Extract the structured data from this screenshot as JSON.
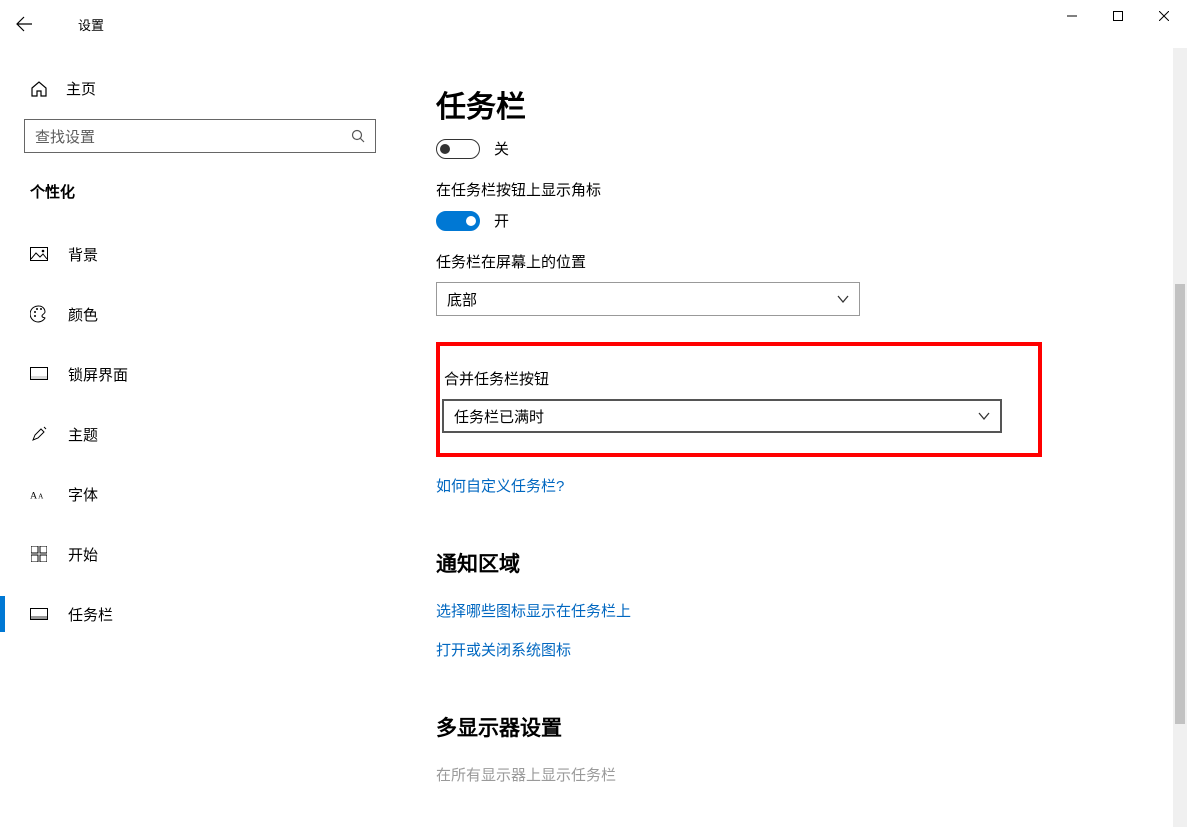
{
  "titlebar": {
    "title": "设置"
  },
  "sidebar": {
    "home": "主页",
    "search_placeholder": "查找设置",
    "section": "个性化",
    "items": [
      {
        "label": "背景"
      },
      {
        "label": "颜色"
      },
      {
        "label": "锁屏界面"
      },
      {
        "label": "主题"
      },
      {
        "label": "字体"
      },
      {
        "label": "开始"
      },
      {
        "label": "任务栏"
      }
    ]
  },
  "content": {
    "page_title": "任务栏",
    "toggle1_state": "关",
    "badges_label": "在任务栏按钮上显示角标",
    "toggle2_state": "开",
    "position_label": "任务栏在屏幕上的位置",
    "position_value": "底部",
    "combine_label": "合并任务栏按钮",
    "combine_value": "任务栏已满时",
    "customize_link": "如何自定义任务栏?"
  },
  "notification": {
    "heading": "通知区域",
    "link1": "选择哪些图标显示在任务栏上",
    "link2": "打开或关闭系统图标"
  },
  "multimon": {
    "heading": "多显示器设置",
    "disabled_label": "在所有显示器上显示任务栏"
  }
}
